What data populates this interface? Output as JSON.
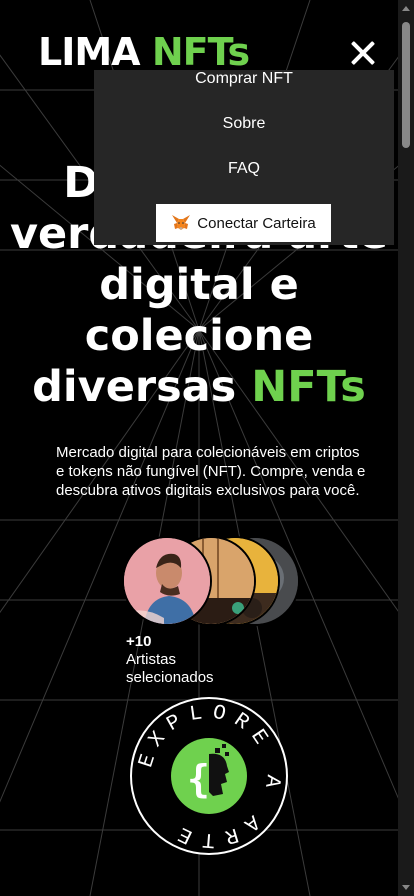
{
  "header": {
    "logo_main": "LIMA",
    "logo_accent": "NFTs"
  },
  "menu": {
    "items": [
      "Comprar NFT",
      "Sobre",
      "FAQ"
    ],
    "wallet_button": "Conectar Carteira",
    "wallet_icon": "metamask-fox-icon",
    "close_icon": "close-icon"
  },
  "hero": {
    "title_line1": "Descubra a",
    "title_line2": "verdadeira arte",
    "title_line3": "digital e",
    "title_line4": "colecione",
    "title_line5_plain": "diversas",
    "title_line5_accent": "NFTs",
    "description": "Mercado digital para colecionáveis em criptos e tokens não fungível (NFT). Compre, venda e descubra ativos digitais exclusivos para você."
  },
  "artists": {
    "count": "+10",
    "label_line1": "Artistas",
    "label_line2": "selecionados"
  },
  "badge": {
    "ring_text": "EXPLORE A ARTE"
  },
  "colors": {
    "accent": "#6fd14e",
    "menu_bg": "#262626",
    "background": "#000000"
  }
}
